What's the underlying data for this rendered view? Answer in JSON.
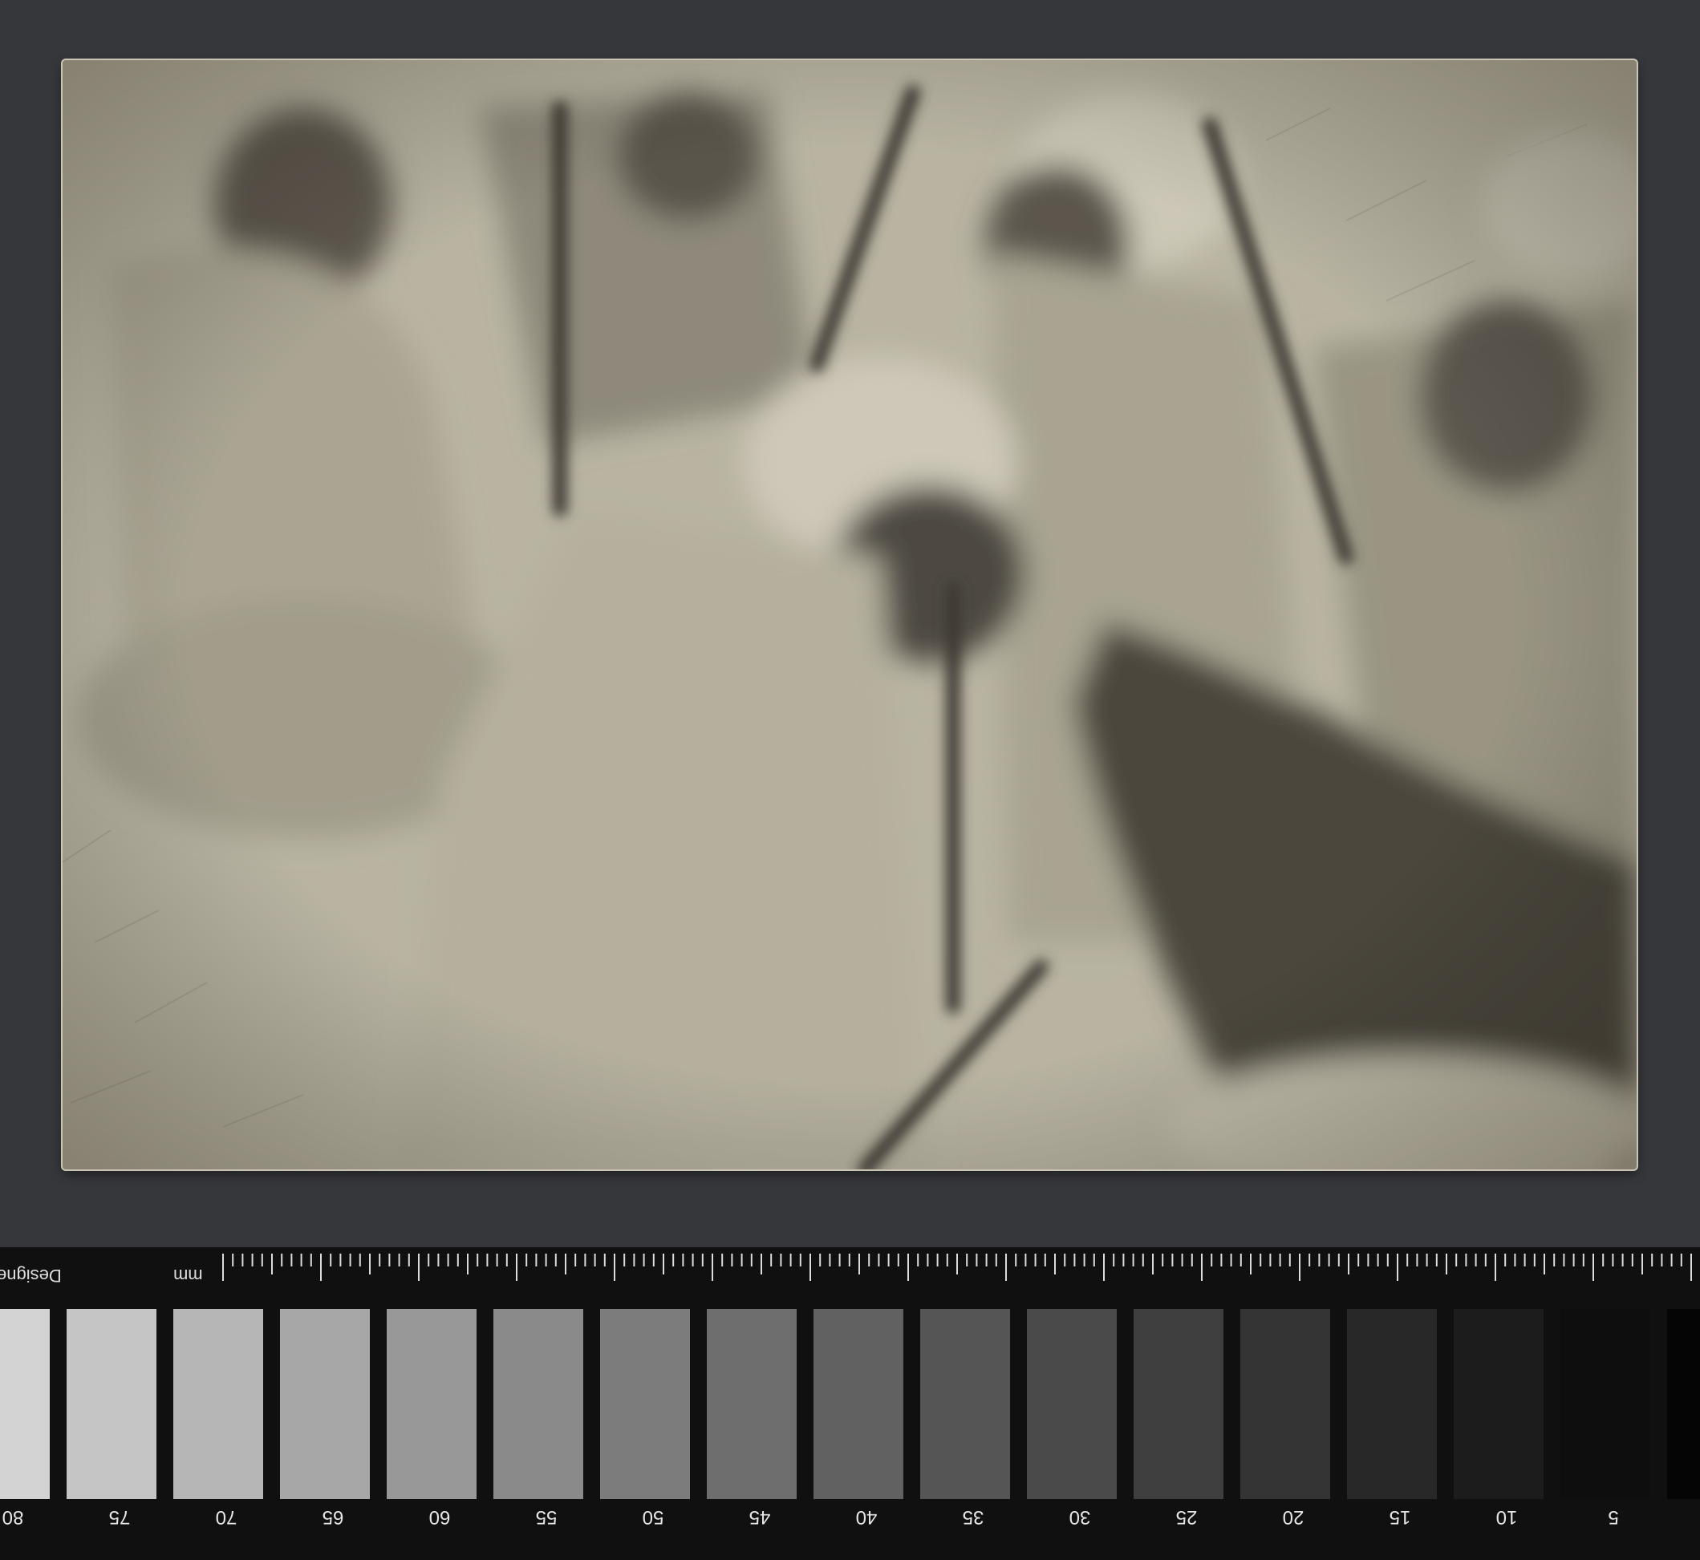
{
  "photo": {
    "description_alt": ""
  },
  "ruler": {
    "unit": "mm",
    "brand": "Designe"
  },
  "gray_scale": {
    "labels": [
      "80",
      "75",
      "70",
      "65",
      "60",
      "55",
      "50",
      "45",
      "40",
      "35",
      "30",
      "25",
      "20",
      "15",
      "10",
      "5"
    ],
    "patch_colors": [
      "#d3d3d3",
      "#c5c5c5",
      "#b6b6b6",
      "#a7a7a7",
      "#989898",
      "#8a8a8a",
      "#7c7c7c",
      "#6e6e6e",
      "#616161",
      "#555555",
      "#4a4a4a",
      "#3f3f3f",
      "#343434",
      "#282828",
      "#1c1c1c",
      "#0e0e0e",
      "#050505"
    ]
  }
}
